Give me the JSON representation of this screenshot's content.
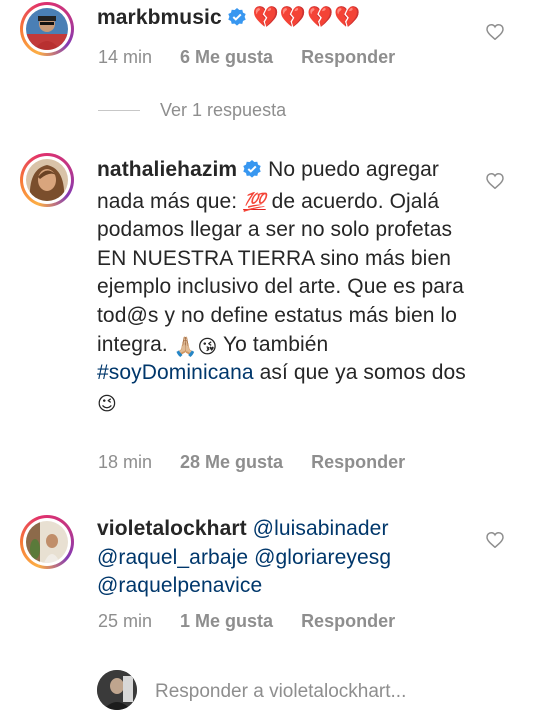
{
  "comments": [
    {
      "username": "markbmusic",
      "text": "",
      "hearts": "💔💔💔💔",
      "time": "14 min",
      "likes": "6 Me gusta",
      "reply": "Responder",
      "view_replies": "Ver 1 respuesta"
    },
    {
      "username": "nathaliehazim",
      "text_part1": "No puedo agregar nada más que: ",
      "hundred": "💯",
      "text_part2": " de acuerdo. Ojalá podamos llegar a ser no solo profetas EN NUESTRA TIERRA sino más bien ejemplo inclusivo del arte. Que es para tod@s y no define estatus más bien lo integra. ",
      "emojis": "🙏🏼😘",
      "text_part3": " Yo también ",
      "hashtag": "#soyDominicana",
      "text_part4": " así que ya somos dos ",
      "wink": "😉",
      "time": "18 min",
      "likes": "28 Me gusta",
      "reply": "Responder"
    },
    {
      "username": "violetalockhart",
      "mention1": "@luisabinader",
      "mention2": "@raquel_arbaje",
      "mention3": "@gloriareyesg",
      "mention4": "@raquelpenavice",
      "time": "25 min",
      "likes": "1 Me gusta",
      "reply": "Responder"
    }
  ],
  "reply_bar": {
    "placeholder": "Responder a violetalockhart..."
  }
}
